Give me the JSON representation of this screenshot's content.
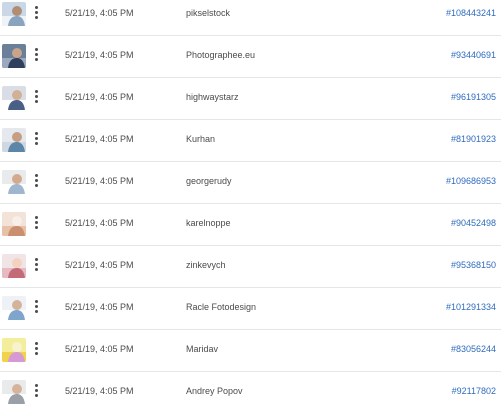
{
  "rows": [
    {
      "date": "5/21/19, 4:05 PM",
      "author": "pikselstock",
      "id": "#108443241",
      "thumb": {
        "bg": "#c9d7e6",
        "a": "#eef3f8",
        "b": "#8aa4c0",
        "c": "#b08e74"
      }
    },
    {
      "date": "5/21/19, 4:05 PM",
      "author": "Photographee.eu",
      "id": "#93440691",
      "thumb": {
        "bg": "#6c7f9a",
        "a": "#9aa9bd",
        "b": "#2f3f5c",
        "c": "#c8a58a"
      }
    },
    {
      "date": "5/21/19, 4:05 PM",
      "author": "highwaystarz",
      "id": "#96191305",
      "thumb": {
        "bg": "#d9dee6",
        "a": "#ffffff",
        "b": "#4a5f86",
        "c": "#d2b096"
      }
    },
    {
      "date": "5/21/19, 4:05 PM",
      "author": "Kurhan",
      "id": "#81901923",
      "thumb": {
        "bg": "#e5e8ec",
        "a": "#cfd8e2",
        "b": "#5b86a8",
        "c": "#c79e84"
      }
    },
    {
      "date": "5/21/19, 4:05 PM",
      "author": "georgerudy",
      "id": "#109686953",
      "thumb": {
        "bg": "#e9eaec",
        "a": "#ffffff",
        "b": "#9fb6cf",
        "c": "#d4aa8f"
      }
    },
    {
      "date": "5/21/19, 4:05 PM",
      "author": "karelnoppe",
      "id": "#90452498",
      "thumb": {
        "bg": "#f2e2d8",
        "a": "#e8c2a8",
        "b": "#c98f6e",
        "c": "#f7efe9"
      }
    },
    {
      "date": "5/21/19, 4:05 PM",
      "author": "zinkevych",
      "id": "#95368150",
      "thumb": {
        "bg": "#f1e4e6",
        "a": "#e8b9c0",
        "b": "#c46b78",
        "c": "#f3d2bf"
      }
    },
    {
      "date": "5/21/19, 4:05 PM",
      "author": "Racle Fotodesign",
      "id": "#101291334",
      "thumb": {
        "bg": "#eef2f6",
        "a": "#ffffff",
        "b": "#7ea6cc",
        "c": "#d4b39b"
      }
    },
    {
      "date": "5/21/19, 4:05 PM",
      "author": "Maridav",
      "id": "#83056244",
      "thumb": {
        "bg": "#f4ee9a",
        "a": "#f1d34a",
        "b": "#d59ad6",
        "c": "#f7f3d0"
      }
    },
    {
      "date": "5/21/19, 4:05 PM",
      "author": "Andrey Popov",
      "id": "#92117802",
      "thumb": {
        "bg": "#e9eaec",
        "a": "#ffffff",
        "b": "#9a9fa8",
        "c": "#d6b39c"
      }
    }
  ]
}
